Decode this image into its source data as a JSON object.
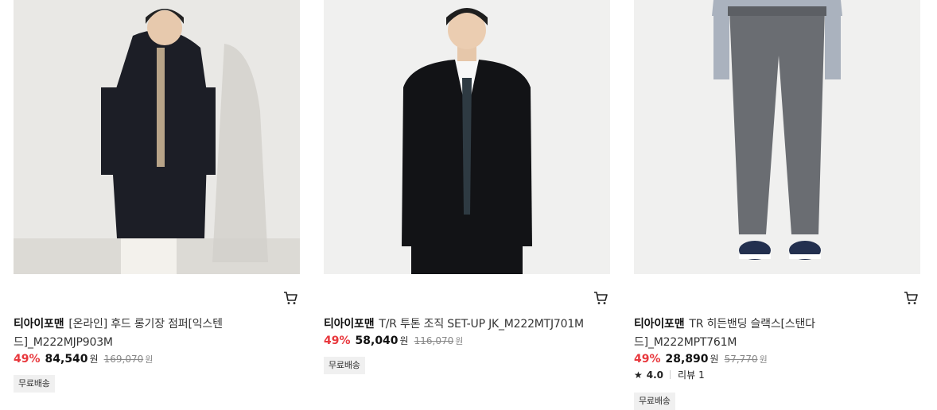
{
  "products": [
    {
      "brand": "티아이포맨",
      "name": "[온라인] 후드 롱기장 점퍼[익스텐드]_M222MJP903M",
      "discount": "49%",
      "price": "84,540",
      "currency": "원",
      "original_price": "169,070",
      "badge": "무료배송",
      "image": "model-long-hooded-jacket"
    },
    {
      "brand": "티아이포맨",
      "name": "T/R 투톤 조직 SET-UP JK_M222MTJ701M",
      "discount": "49%",
      "price": "58,040",
      "currency": "원",
      "original_price": "116,070",
      "badge": "무료배송",
      "image": "model-black-suit-jacket"
    },
    {
      "brand": "티아이포맨",
      "name": "TR 히든밴딩 슬랙스[스탠다드]_M222MPT761M",
      "discount": "49%",
      "price": "28,890",
      "currency": "원",
      "original_price": "57,770",
      "rating": "4.0",
      "review_label": "리뷰",
      "review_count": "1",
      "badge": "무료배송",
      "image": "model-gray-slacks"
    }
  ],
  "icons": {
    "cart": "cart-icon",
    "star": "star-icon"
  },
  "colors": {
    "discount": "#e8383d",
    "badge_bg": "#f0f0f0"
  }
}
